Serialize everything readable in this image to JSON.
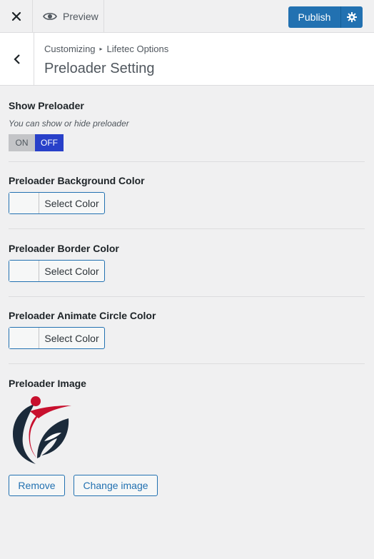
{
  "toolbar": {
    "close_icon": "close-icon",
    "preview_label": "Preview",
    "publish_label": "Publish"
  },
  "section": {
    "breadcrumb_root": "Customizing",
    "breadcrumb_parent": "Lifetec Options",
    "title": "Preloader Setting"
  },
  "controls": {
    "show_preloader": {
      "title": "Show Preloader",
      "description": "You can show or hide preloader",
      "on_label": "ON",
      "off_label": "OFF",
      "selected": "OFF"
    },
    "background_color": {
      "title": "Preloader Background Color",
      "button_label": "Select Color"
    },
    "border_color": {
      "title": "Preloader Border Color",
      "button_label": "Select Color"
    },
    "circle_color": {
      "title": "Preloader Animate Circle Color",
      "button_label": "Select Color"
    },
    "image": {
      "title": "Preloader Image",
      "remove_label": "Remove",
      "change_label": "Change image"
    }
  },
  "colors": {
    "accent": "#2271b1",
    "toggle_active": "#2840c9",
    "logo_red": "#c8102e",
    "logo_navy": "#1b2a3a"
  }
}
